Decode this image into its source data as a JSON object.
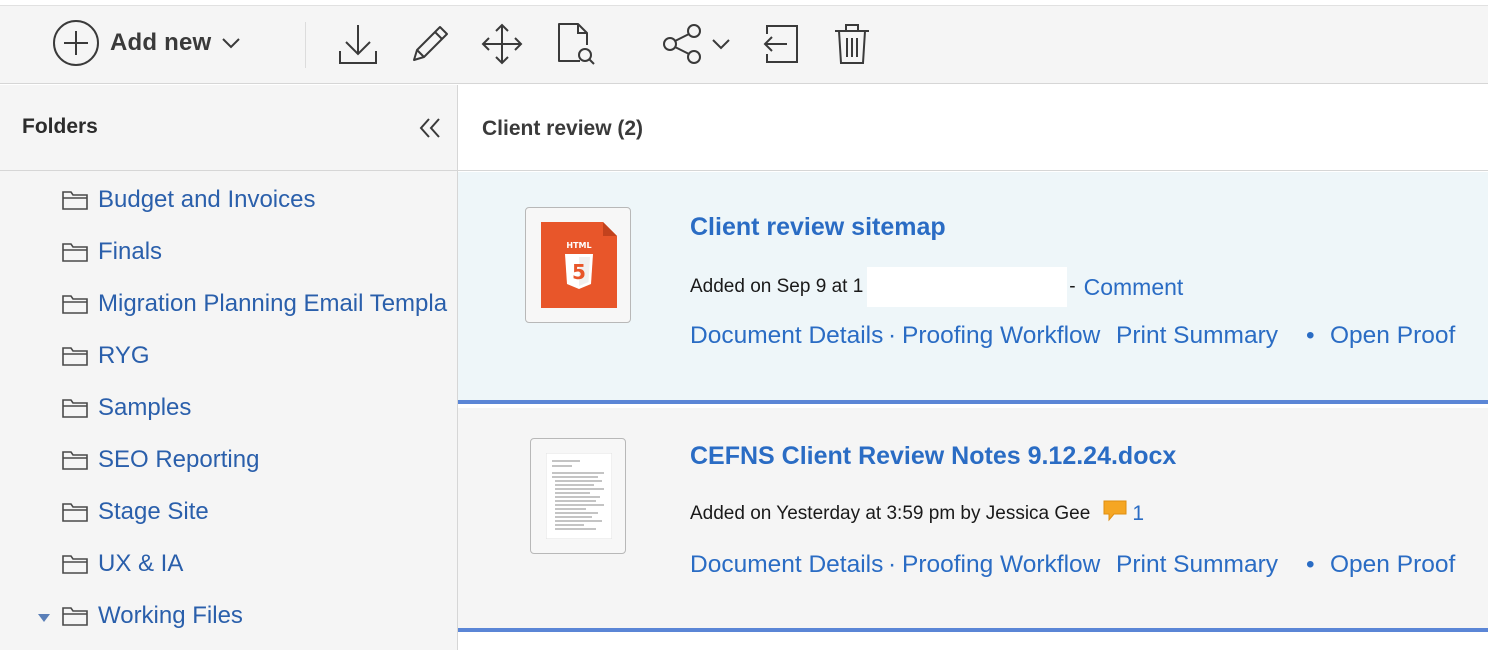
{
  "toolbar": {
    "add_new_label": "Add new",
    "icons": [
      "add-circle-icon",
      "download-icon",
      "edit-pencil-icon",
      "move-icon",
      "search-document-icon",
      "share-icon",
      "exit-icon",
      "trash-icon"
    ]
  },
  "sidebar": {
    "title": "Folders",
    "folders": [
      {
        "label": "Budget and Invoices",
        "expanded": false
      },
      {
        "label": "Finals",
        "expanded": false
      },
      {
        "label": "Migration Planning Email Templa",
        "expanded": false
      },
      {
        "label": "RYG",
        "expanded": false
      },
      {
        "label": "Samples",
        "expanded": false
      },
      {
        "label": "SEO Reporting",
        "expanded": false
      },
      {
        "label": "Stage Site",
        "expanded": false
      },
      {
        "label": "UX & IA",
        "expanded": false
      },
      {
        "label": "Working Files",
        "expanded": true
      }
    ]
  },
  "main": {
    "title": "Client review (2)",
    "documents": [
      {
        "title": "Client review sitemap",
        "meta": "Added on Sep 9 at 1",
        "meta_tail": "-",
        "comment_label": "Comment",
        "links": [
          "Document Details",
          "Proofing Workflow",
          "Print Summary",
          "Open Proof"
        ],
        "thumb_icon": "html5-icon",
        "thumb_badge": "HTML"
      },
      {
        "title": "CEFNS Client Review Notes 9.12.24.docx",
        "meta": "Added on Yesterday at 3:59 pm by Jessica Gee",
        "comment_count": "1",
        "links": [
          "Document Details",
          "Proofing Workflow",
          "Print Summary",
          "Open Proof"
        ],
        "thumb_icon": "document-preview-icon"
      }
    ],
    "separators": {
      "dot": "·",
      "bullet": "•"
    }
  },
  "colors": {
    "link": "#2a6cc4",
    "folder_link": "#2a5fab",
    "row_highlight": "#eef6f9",
    "row_border": "#5b86d6",
    "html5_orange": "#e8562a",
    "comment_orange": "#f5a623"
  }
}
